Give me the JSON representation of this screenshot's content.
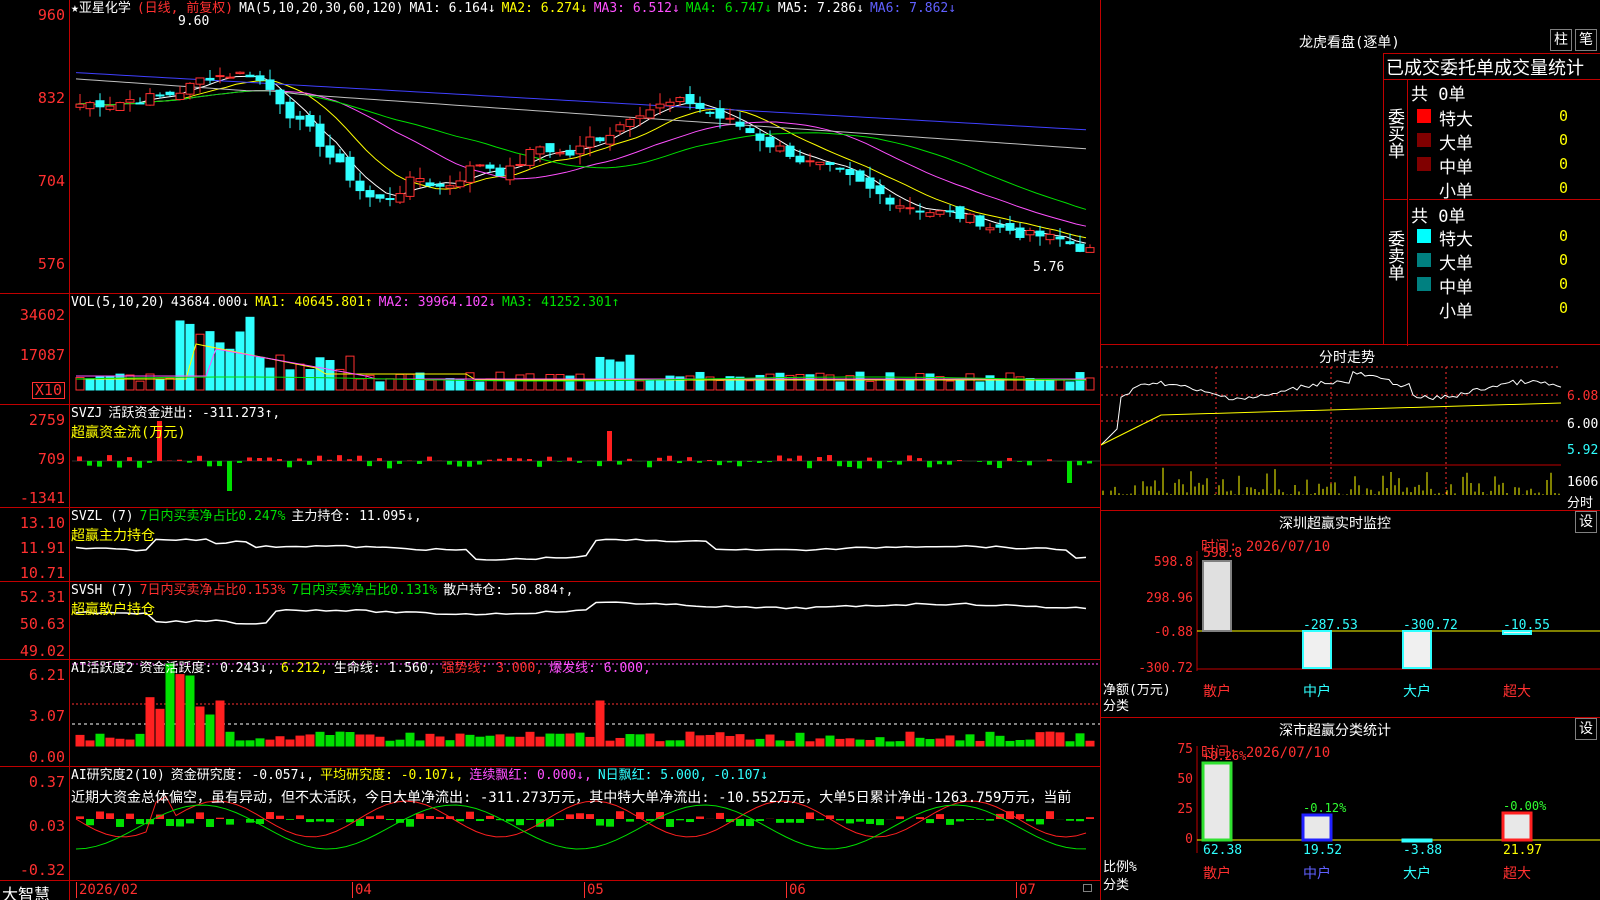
{
  "price": {
    "title": "★亚星化学",
    "period": "(日线, 前复权)",
    "ma_label": "MA(5,10,20,30,60,120)",
    "ma": [
      "MA1: 6.164↓",
      "MA2: 6.274↓",
      "MA3: 6.512↓",
      "MA4: 6.747↓",
      "MA5: 7.286↓",
      "MA6: 7.862↓"
    ],
    "ticks": [
      "960",
      "832",
      "704",
      "576"
    ],
    "high_label": "9.60",
    "low_label": "5.76"
  },
  "vol": {
    "label": "VOL(5,10,20)",
    "value": "43684.000↓",
    "ma1": "MA1: 40645.801↑",
    "ma2": "MA2: 39964.102↓",
    "ma3": "MA3: 41252.301↑",
    "ticks": [
      "34602",
      "17087"
    ],
    "unit": "X10"
  },
  "svzj": {
    "label": "SVZJ",
    "desc": "活跃资金进出: -311.273↑,",
    "sub": "超赢资金流(万元)",
    "ticks": [
      "2759",
      "709",
      "-1341"
    ]
  },
  "svzl": {
    "label": "SVZL (7)",
    "a": "7日内买卖净占比0.247%",
    "b": "主力持仓: 11.095↓,",
    "sub": "超赢主力持仓",
    "ticks": [
      "13.10",
      "11.91",
      "10.71"
    ]
  },
  "svsh": {
    "label": "SVSH (7)",
    "a": "7日内买卖净占比0.153%",
    "b": "7日内买卖净占比0.131%",
    "c": "散户持仓: 50.884↑,",
    "sub": "超赢散户持仓",
    "ticks": [
      "52.31",
      "50.63",
      "49.02"
    ]
  },
  "ai1": {
    "label": "AI活跃度2",
    "a": "资金活跃度: 0.243↓,",
    "b": "6.212,",
    "c": "生命线: 1.560,",
    "d": "强势线: 3.000,",
    "e": "爆发线: 6.000,",
    "ticks": [
      "6.21",
      "3.07",
      "0.00"
    ]
  },
  "ai2": {
    "label": "AI研究度2(10)",
    "a": "资金研究度: -0.057↓,",
    "b": "平均研究度: -0.107↓,",
    "c": "连续飘红: 0.000↓,",
    "d": "N日飘红: 5.000,",
    "e": "-0.107↓",
    "text": "近期大资金总体偏空，虽有异动，但不太活跃，今日大单净流出: -311.273万元，其中特大单净流出: -10.552万元，大单5日累计净出-1263.759万元，当前",
    "ticks": [
      "0.37",
      "0.03",
      "-0.32"
    ]
  },
  "dates": [
    "2026/02",
    "04",
    "05",
    "06",
    "07"
  ],
  "brand": "大智慧",
  "dragon": {
    "title": "龙虎看盘(逐单)",
    "btn1": "柱",
    "btn2": "笔",
    "header": "已成交委托单成交量统计",
    "buy": "委买单",
    "sell": "委卖单",
    "buy_total": "共 0单",
    "sell_total": "共 0单",
    "rows": [
      "特大",
      "大单",
      "中单",
      "小单"
    ],
    "zero": "0",
    "pct": "0%",
    "buy_colors": [
      "#ff0000",
      "#800000",
      "#800000",
      "#000000"
    ],
    "sell_colors": [
      "#00ffff",
      "#008080",
      "#008080",
      "#000000"
    ]
  },
  "intraday": {
    "title": "分时走势",
    "ticks": [
      "6.08",
      "6.00",
      "5.92"
    ],
    "vol_tick": "1606",
    "vol_label": "分时"
  },
  "monitor": {
    "title": "深圳超赢实时监控",
    "btn": "设",
    "time": "时间: 2026/07/10",
    "ticks": [
      "598.8",
      "298.96",
      "-0.88",
      "-300.72"
    ],
    "ylabel": "净额(万元)",
    "xlabel": "分类",
    "categories": [
      "散户",
      "中户",
      "大户",
      "超大"
    ],
    "values": [
      "598.8",
      "-287.53",
      "-300.72",
      "-10.55"
    ]
  },
  "stats": {
    "title": "深市超赢分类统计",
    "btn": "设",
    "time": "时间: 2026/07/10",
    "ticks": [
      "75",
      "50",
      "25",
      "0"
    ],
    "ylabel": "比例%",
    "xlabel": "分类",
    "categories": [
      "散户",
      "中户",
      "大户",
      "超大"
    ],
    "top": [
      "+0.26%",
      "-0.12%",
      "",
      "-0.00%"
    ],
    "values": [
      "62.38",
      "19.52",
      "-3.88",
      "21.97"
    ]
  }
}
